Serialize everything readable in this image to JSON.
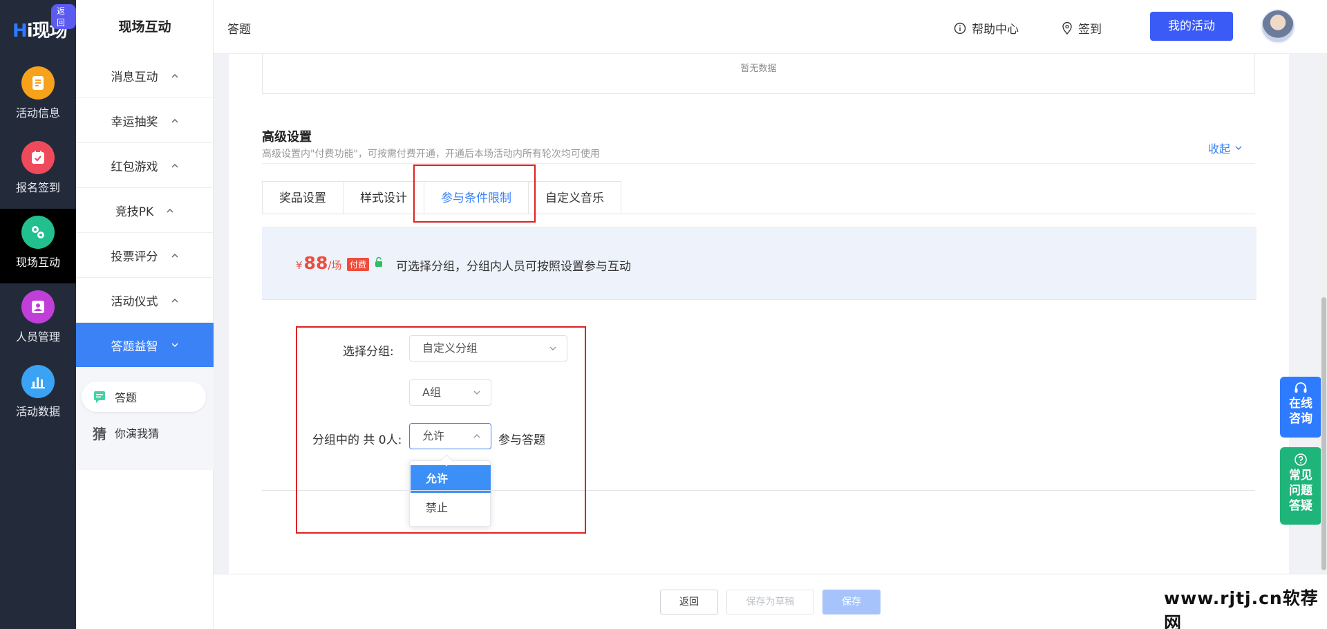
{
  "brand": {
    "logo_text": "Hi现场",
    "back_badge": "返回"
  },
  "rail": [
    {
      "label": "活动信息",
      "color": "#f7a21b",
      "icon": "document-icon"
    },
    {
      "label": "报名签到",
      "color": "#ef4a5c",
      "icon": "calendar-check-icon"
    },
    {
      "label": "现场互动",
      "color": "#22c08e",
      "icon": "interact-icon"
    },
    {
      "label": "人员管理",
      "color": "#c13fd9",
      "icon": "person-card-icon"
    },
    {
      "label": "活动数据",
      "color": "#3aa3f5",
      "icon": "bar-chart-icon"
    }
  ],
  "submenu": {
    "title": "现场互动",
    "items": [
      {
        "label": "消息互动"
      },
      {
        "label": "幸运抽奖"
      },
      {
        "label": "红包游戏"
      },
      {
        "label": "竞技PK"
      },
      {
        "label": "投票评分"
      },
      {
        "label": "活动仪式"
      },
      {
        "label": "答题益智"
      }
    ],
    "children": [
      {
        "label": "答题"
      },
      {
        "label": "你演我猜",
        "glyph": "猜"
      }
    ]
  },
  "topbar": {
    "page_title": "答题",
    "help": "帮助中心",
    "checkin": "签到",
    "my_activity": "我的活动"
  },
  "nodata": "暂无数据",
  "advanced": {
    "title": "高级设置",
    "desc": "高级设置内\"付费功能\"，可按需付费开通，开通后本场活动内所有轮次均可使用",
    "collapse": "收起"
  },
  "tabs": [
    {
      "label": "奖品设置"
    },
    {
      "label": "样式设计"
    },
    {
      "label": "参与条件限制"
    },
    {
      "label": "自定义音乐"
    }
  ],
  "pay": {
    "yen": "¥",
    "price": "88",
    "unit": "/场",
    "tag": "付费",
    "desc": "可选择分组，分组内人员可按照设置参与互动"
  },
  "form": {
    "group_label": "选择分组:",
    "group_value": "自定义分组",
    "subgroup_value": "A组",
    "count_label": "分组中的 共 0人:",
    "permission_value": "允许",
    "after_text": "参与答题",
    "options": [
      "允许",
      "禁止"
    ]
  },
  "footer": {
    "back": "返回",
    "draft": "保存为草稿",
    "save": "保存"
  },
  "float": {
    "consult": "在线咨询",
    "faq": "常见问题答疑"
  },
  "watermark": "www.rjtj.cn软荐网"
}
